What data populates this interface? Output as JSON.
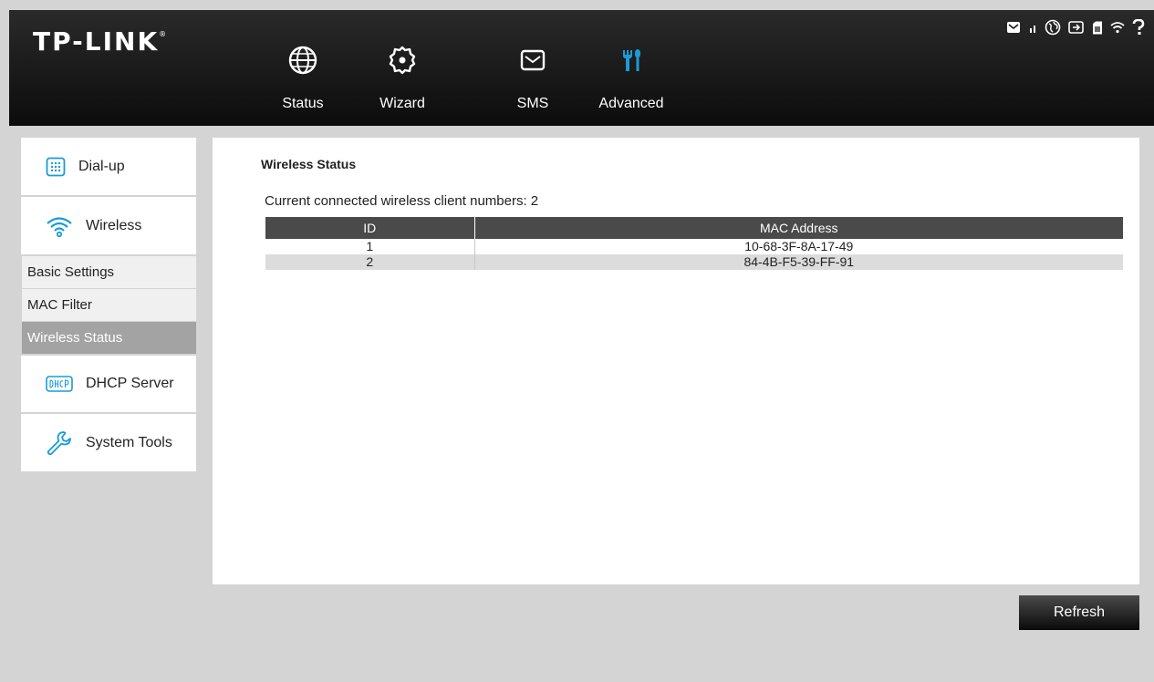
{
  "header": {
    "logo": "TP-LINK",
    "logo_mark": "®",
    "nav": [
      {
        "label": "Status",
        "icon": "globe-icon"
      },
      {
        "label": "Wizard",
        "icon": "gear-icon"
      },
      {
        "label": "SMS",
        "icon": "envelope-icon"
      },
      {
        "label": "Advanced",
        "icon": "tools-icon"
      }
    ],
    "active_nav": "Advanced",
    "accent_color": "#1a9bd7",
    "status_icons": [
      "message-icon",
      "signal-icon",
      "internet-icon",
      "battery-icon",
      "sim-icon",
      "wifi-icon",
      "help-icon"
    ]
  },
  "sidebar": {
    "items": [
      {
        "label": "Dial-up",
        "icon": "dialpad-icon"
      },
      {
        "label": "Wireless",
        "icon": "wifi-icon"
      },
      {
        "label": "DHCP Server",
        "icon": "dhcp-icon"
      },
      {
        "label": "System Tools",
        "icon": "wrench-icon"
      }
    ],
    "wireless_subitems": [
      "Basic Settings",
      "MAC Filter",
      "Wireless Status"
    ],
    "active_subitem": "Wireless Status",
    "icon_color": "#1a9bd7"
  },
  "main": {
    "title": "Wireless Status",
    "client_count_text": "Current connected wireless client numbers: 2",
    "table": {
      "headers": [
        "ID",
        "MAC Address"
      ],
      "rows": [
        {
          "id": "1",
          "mac": "10-68-3F-8A-17-49"
        },
        {
          "id": "2",
          "mac": "84-4B-F5-39-FF-91"
        }
      ]
    }
  },
  "footer": {
    "refresh_label": "Refresh"
  }
}
